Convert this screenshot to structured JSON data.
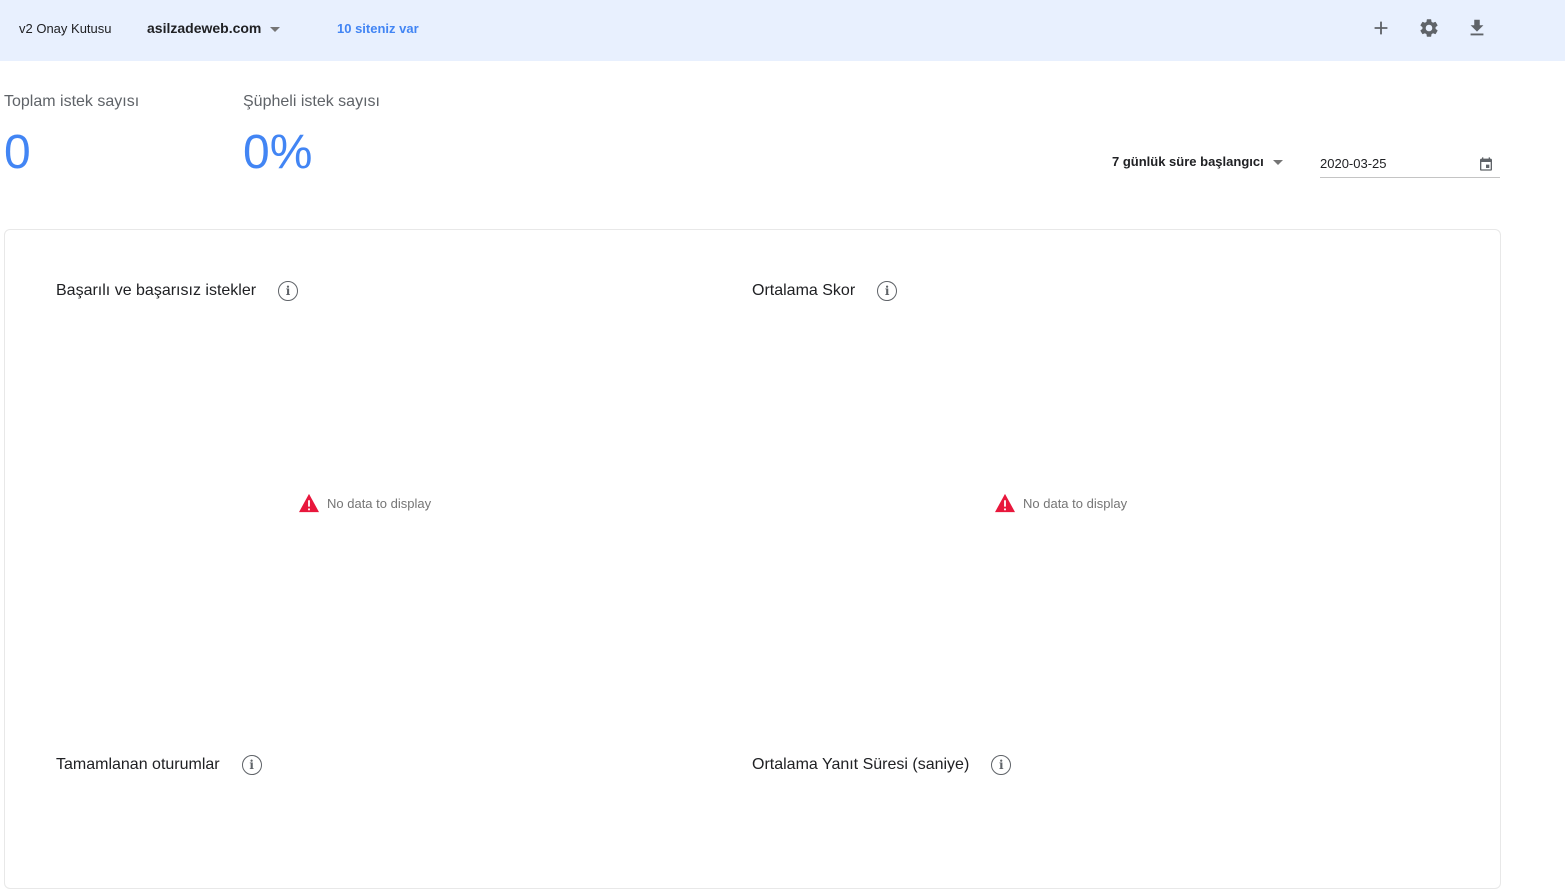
{
  "header": {
    "brand": "v2 Onay Kutusu",
    "site_name": "asilzadeweb.com",
    "site_count": "10 siteniz var",
    "icons": [
      "add-icon",
      "settings-icon",
      "download-icon"
    ]
  },
  "stats": {
    "total_label": "Toplam istek sayısı",
    "total_value": "0",
    "suspicious_label": "Şüpheli istek sayısı",
    "suspicious_value": "0%"
  },
  "filters": {
    "range_label": "7 günlük süre başlangıcı",
    "date_value": "2020-03-25"
  },
  "panels": [
    {
      "title": "Başarılı ve başarısız istekler",
      "message": "No data to display"
    },
    {
      "title": "Ortalama Skor",
      "message": "No data to display"
    },
    {
      "title": "Tamamlanan oturumlar"
    },
    {
      "title": "Ortalama Yanıt Süresi (saniye)"
    }
  ],
  "colors": {
    "accent": "#4285f4",
    "header_bg": "#e8f0fe",
    "warning": "#e8173c"
  }
}
